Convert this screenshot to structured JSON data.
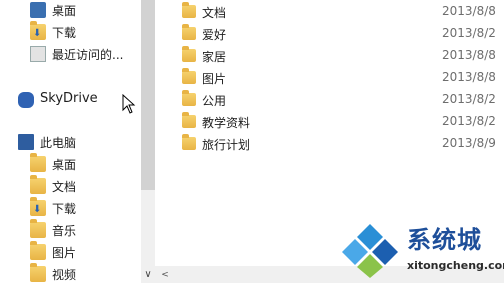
{
  "nav": {
    "items": [
      {
        "label": "桌面",
        "icon": "desktop-icon"
      },
      {
        "label": "下载",
        "icon": "download-folder-icon"
      },
      {
        "label": "最近访问的...",
        "icon": "recent-places-icon"
      },
      {
        "label": "SkyDrive",
        "icon": "skydrive-cloud-icon"
      },
      {
        "label": "此电脑",
        "icon": "this-pc-icon"
      },
      {
        "label": "桌面",
        "icon": "desktop-folder-icon"
      },
      {
        "label": "文档",
        "icon": "documents-folder-icon"
      },
      {
        "label": "下载",
        "icon": "downloads-folder-icon"
      },
      {
        "label": "音乐",
        "icon": "music-folder-icon"
      },
      {
        "label": "图片",
        "icon": "pictures-folder-icon"
      },
      {
        "label": "视频",
        "icon": "videos-folder-icon"
      }
    ]
  },
  "files": [
    {
      "name": "文档",
      "date": "2013/8/8"
    },
    {
      "name": "爱好",
      "date": "2013/8/2"
    },
    {
      "name": "家居",
      "date": "2013/8/8"
    },
    {
      "name": "图片",
      "date": "2013/8/8"
    },
    {
      "name": "公用",
      "date": "2013/8/2"
    },
    {
      "name": "教学资料",
      "date": "2013/8/2"
    },
    {
      "name": "旅行计划",
      "date": "2013/8/9"
    }
  ],
  "watermark": {
    "title": "系统城",
    "url": "xitongcheng.com"
  },
  "colors": {
    "folder": "#f0c75a",
    "accent": "#2f62b3",
    "date_text": "#6d6d6d"
  }
}
